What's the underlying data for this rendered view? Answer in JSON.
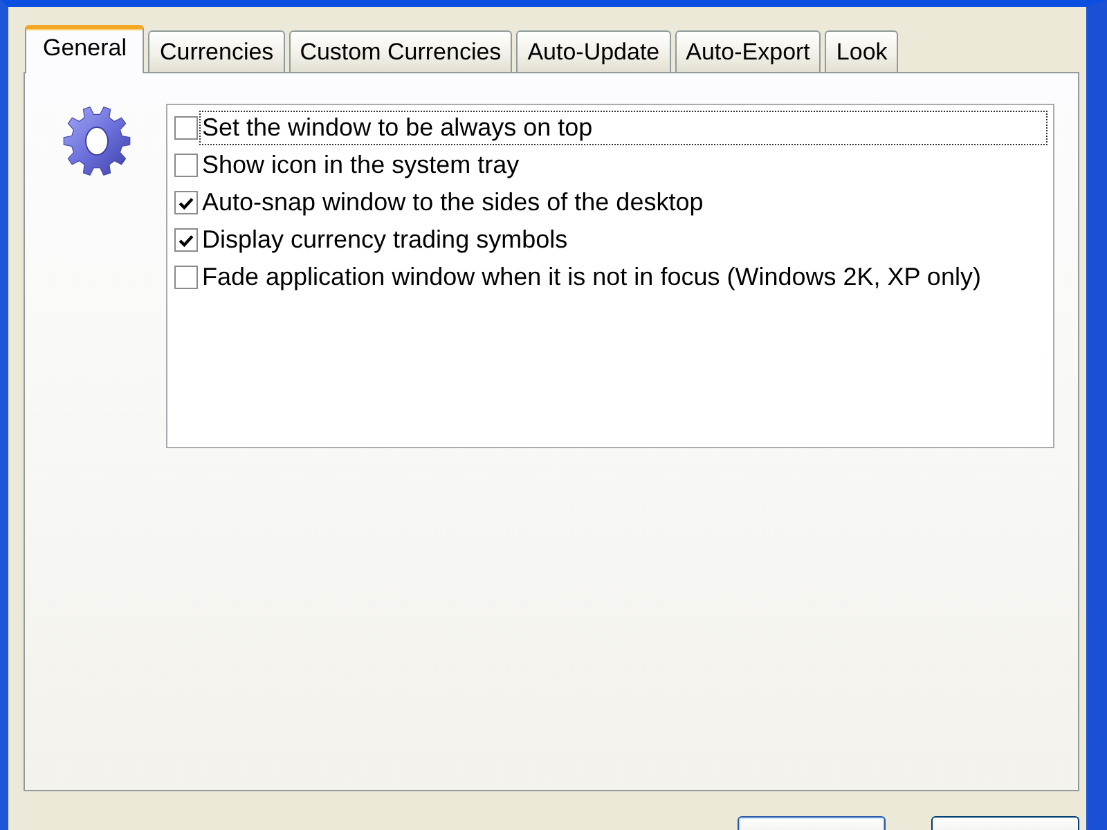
{
  "tabs": [
    {
      "label": "General",
      "selected": true
    },
    {
      "label": "Currencies",
      "selected": false
    },
    {
      "label": "Custom Currencies",
      "selected": false
    },
    {
      "label": "Auto-Update",
      "selected": false
    },
    {
      "label": "Auto-Export",
      "selected": false
    },
    {
      "label": "Look",
      "selected": false
    }
  ],
  "options": [
    {
      "label": "Set the window to be always on top",
      "checked": false,
      "focused": true
    },
    {
      "label": "Show icon in the system tray",
      "checked": false,
      "focused": false
    },
    {
      "label": "Auto-snap window to the sides of the desktop",
      "checked": true,
      "focused": false
    },
    {
      "label": "Display currency trading symbols",
      "checked": true,
      "focused": false
    },
    {
      "label": "Fade application window when it is not in focus (Windows 2K, XP only)",
      "checked": false,
      "focused": false
    }
  ],
  "buttons": [
    {
      "default": true
    },
    {
      "default": false
    }
  ]
}
